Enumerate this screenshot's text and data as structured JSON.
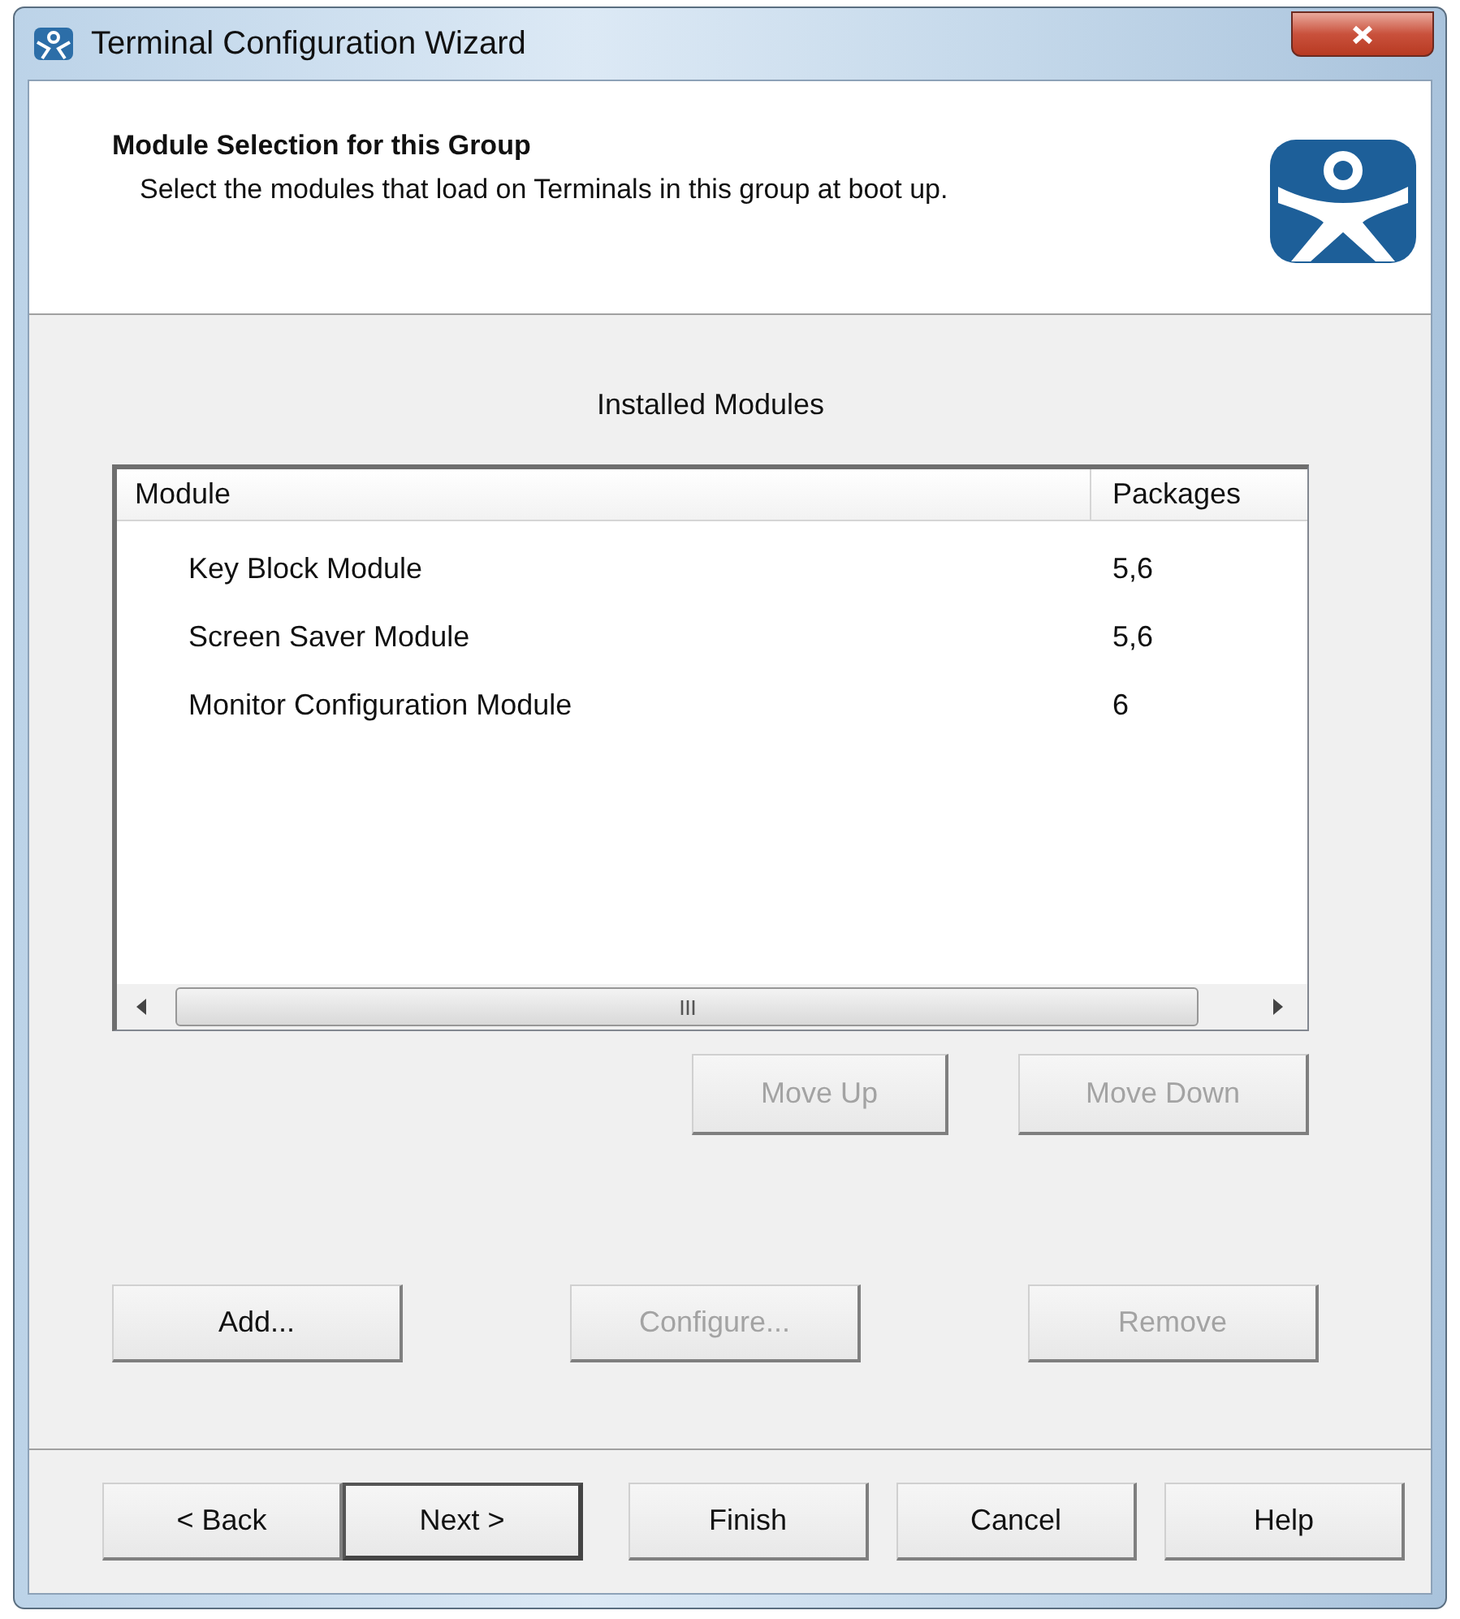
{
  "window": {
    "title": "Terminal Configuration Wizard"
  },
  "header": {
    "title": "Module Selection for this Group",
    "subtitle": "Select the modules that load on Terminals in this group at boot up."
  },
  "list_label": "Installed Modules",
  "table": {
    "columns": [
      "Module",
      "Packages"
    ],
    "rows": [
      {
        "module": "Key Block Module",
        "packages": "5,6"
      },
      {
        "module": "Screen Saver Module",
        "packages": "5,6"
      },
      {
        "module": "Monitor Configuration Module",
        "packages": "6"
      }
    ]
  },
  "order_buttons": [
    {
      "label": "Move Up",
      "disabled": true
    },
    {
      "label": "Move Down",
      "disabled": true
    }
  ],
  "module_buttons": [
    {
      "label": "Add...",
      "disabled": false
    },
    {
      "label": "Configure...",
      "disabled": true
    },
    {
      "label": "Remove",
      "disabled": true
    }
  ],
  "nav_buttons": [
    {
      "label": "< Back",
      "default": false
    },
    {
      "label": "Next >",
      "default": true
    },
    {
      "label": "Finish",
      "default": false
    },
    {
      "label": "Cancel",
      "default": false
    },
    {
      "label": "Help",
      "default": false
    }
  ]
}
